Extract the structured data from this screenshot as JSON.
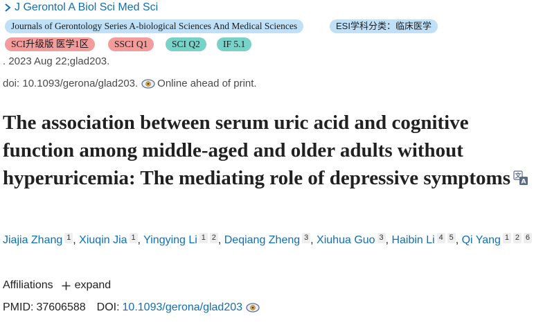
{
  "journal": {
    "name": "J Gerontol A Biol Sci Med Sci"
  },
  "tags": {
    "full_name": "Journals of Gerontology Series A-biological Sciences And Medical Sciences",
    "esi": "ESI学科分类：临床医学",
    "sci_zone": "SCI升级版 医学1区",
    "ssci": "SSCI Q1",
    "sci": "SCI Q2",
    "if": "IF 5.1"
  },
  "citation": {
    "date_line": ". 2023 Aug 22;glad203.",
    "doi_prefix": "doi: 10.1093/gerona/glad203.",
    "status": "Online ahead of print."
  },
  "article": {
    "title": "The association between serum uric acid and cognitive function among middle-aged and older adults without hyperuricemia: The mediating role of depressive symptoms"
  },
  "authors": [
    {
      "name": "Jiajia Zhang",
      "affs": [
        "1"
      ]
    },
    {
      "name": "Xiuqin Jia",
      "affs": [
        "1"
      ]
    },
    {
      "name": "Yingying Li",
      "affs": [
        "1",
        "2"
      ]
    },
    {
      "name": "Deqiang Zheng",
      "affs": [
        "3"
      ]
    },
    {
      "name": "Xiuhua Guo",
      "affs": [
        "3"
      ]
    },
    {
      "name": "Haibin Li",
      "affs": [
        "4",
        "5"
      ]
    },
    {
      "name": "Qi Yang",
      "affs": [
        "1",
        "2",
        "6"
      ]
    }
  ],
  "affiliations": {
    "label": "Affiliations",
    "expand_label": "expand"
  },
  "identifiers": {
    "pmid_label": "PMID:",
    "pmid": "37606588",
    "doi_label": "DOI:",
    "doi": "10.1093/gerona/glad203"
  },
  "colors": {
    "link": "#0f6fb5",
    "tag_blue": "#bfe0f6",
    "tag_red": "#f29c9c",
    "tag_teal": "#79d2c7"
  },
  "icons": [
    "chevron-right-icon",
    "full-text-eye-icon",
    "translate-icon",
    "plus-icon"
  ]
}
